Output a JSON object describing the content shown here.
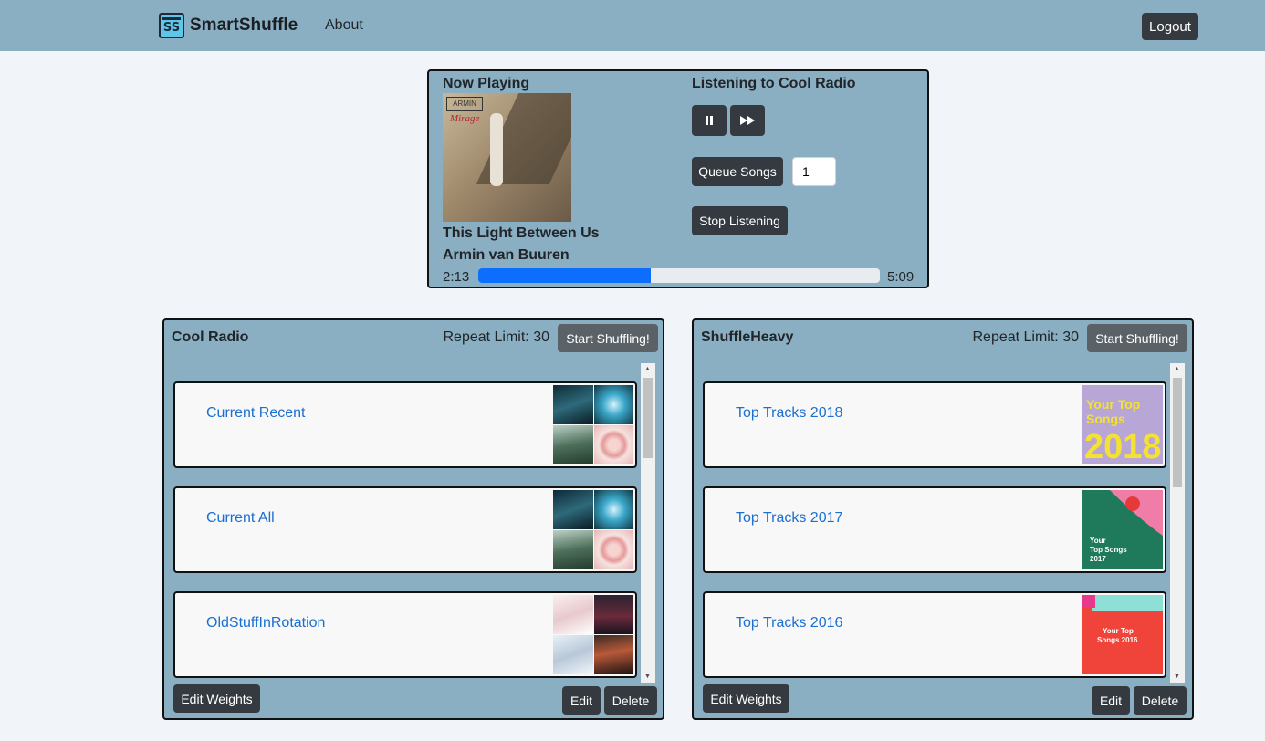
{
  "nav": {
    "logo_text": "SS",
    "brand": "SmartShuffle",
    "about": "About",
    "logout": "Logout"
  },
  "player": {
    "now_playing_label": "Now Playing",
    "album_logo": "ARMIN",
    "album_script": "Mirage",
    "song_title": "This Light Between Us",
    "artist": "Armin van Buuren",
    "time_current": "2:13",
    "time_total": "5:09",
    "progress_fraction": 0.43,
    "listening_label": "Listening to Cool Radio",
    "pause_icon": "pause-icon",
    "skip_icon": "fast-forward-icon",
    "queue_label": "Queue Songs",
    "queue_value": "1",
    "stop_label": "Stop Listening"
  },
  "panels": [
    {
      "name": "Cool Radio",
      "repeat_limit": "Repeat Limit: 30",
      "shuffle_label": "Start Shuffling!",
      "items": [
        {
          "title": "Current Recent"
        },
        {
          "title": "Current All"
        },
        {
          "title": "OldStuffInRotation"
        }
      ],
      "edit_weights": "Edit Weights",
      "edit": "Edit",
      "delete": "Delete"
    },
    {
      "name": "ShuffleHeavy",
      "repeat_limit": "Repeat Limit: 30",
      "shuffle_label": "Start Shuffling!",
      "items": [
        {
          "title": "Top Tracks 2018",
          "art_text": "Your Top Songs 2018"
        },
        {
          "title": "Top Tracks 2017",
          "art_text": "Your Top Songs 2017"
        },
        {
          "title": "Top Tracks 2016",
          "art_text": "Your Top Songs 2016"
        }
      ],
      "edit_weights": "Edit Weights",
      "edit": "Edit",
      "delete": "Delete"
    }
  ],
  "colors": {
    "navbar": "#8aafc2",
    "background": "#f1f5f9",
    "button_dark": "#343a40",
    "progress": "#0d6efd",
    "link": "#1a6fd1"
  }
}
